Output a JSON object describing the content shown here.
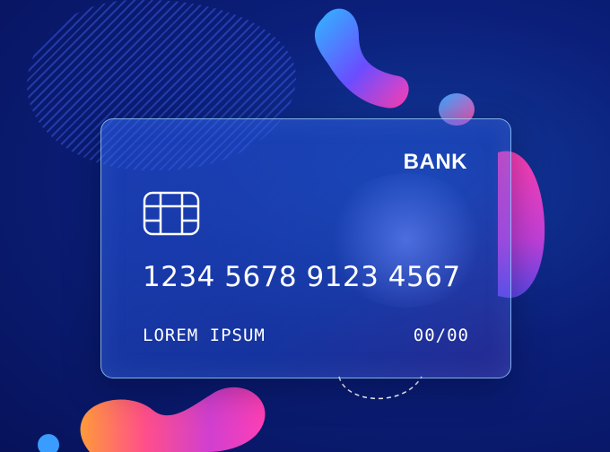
{
  "card": {
    "bank_name": "BANK",
    "number": "1234 5678 9123 4567",
    "holder": "LOREM IPSUM",
    "expiry": "00/00"
  },
  "icons": {
    "chip": "card-chip-icon"
  },
  "colors": {
    "background": "#0b1f7a",
    "blob_pink": "#ff3fb4",
    "blob_blue": "#2fa8ff",
    "blob_orange": "#ff8a4a"
  }
}
